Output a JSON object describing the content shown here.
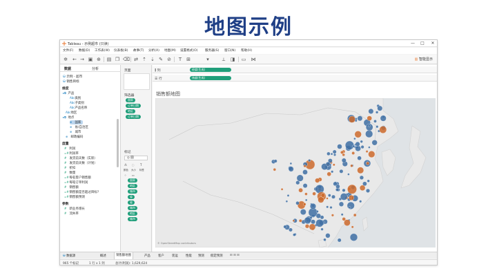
{
  "slide": {
    "title": "地图示例"
  },
  "window": {
    "title": "Tableau - 示例超市 (只读)",
    "controls": [
      "—",
      "□",
      "✕"
    ],
    "menu": [
      "文件(F)",
      "数据(D)",
      "工作表(W)",
      "仪表板(B)",
      "故事(T)",
      "分析(A)",
      "地图(M)",
      "设置格式(O)",
      "服务器(S)",
      "窗口(N)",
      "帮助(H)"
    ],
    "show_me": "智能显示"
  },
  "data_pane": {
    "tabs": [
      "数据",
      "分析"
    ],
    "datasources": [
      "示例 - 超市",
      "销售目标"
    ],
    "dimensions_label": "维度",
    "dimensions": [
      {
        "label": "产品",
        "type": "folder"
      },
      {
        "label": "类别",
        "type": "abc"
      },
      {
        "label": "子类别",
        "type": "abc"
      },
      {
        "label": "产品名称",
        "type": "abc"
      },
      {
        "label": "地区",
        "type": "abc"
      },
      {
        "label": "地点",
        "type": "folder"
      },
      {
        "label": "国家",
        "type": "geo",
        "selected": true
      },
      {
        "label": "省/自治区",
        "type": "geo"
      },
      {
        "label": "城市",
        "type": "geo"
      },
      {
        "label": "邮政编码",
        "type": "geo"
      }
    ],
    "measures_label": "度量",
    "measures": [
      "利润",
      "利润率",
      "发货前天数（实际）",
      "发货前天数（计划）",
      "折扣",
      "数量",
      "每名客户销售额",
      "每笔订单利润",
      "销售额",
      "销售额是否超过目标？",
      "销售额预测"
    ],
    "parameters_label": "参数",
    "parameters": [
      "新业务增长",
      "流失率"
    ]
  },
  "middle_pane": {
    "pages_label": "页面",
    "filters_label": "筛选器",
    "filters": [
      "国家",
      "订单日期",
      "地区",
      "订单日期"
    ],
    "marks_label": "标记",
    "mark_type": "◎ 圆",
    "mark_buttons": [
      "颜色",
      "大小",
      "标签",
      "详细信息",
      "工具提示"
    ],
    "mark_pills": [
      "国家",
      "地区",
      "城市",
      "省",
      "省",
      "城市",
      "地区",
      "城市"
    ]
  },
  "view": {
    "columns_label": "列",
    "rows_label": "行",
    "columns_pill": "经度(生成)",
    "rows_pill": "纬度(生成)",
    "sheet_title": "销售额地图",
    "attribution": "© OpenStreetMap contributors"
  },
  "tabs": {
    "data_source": "数据源",
    "sheets": [
      "概述",
      "销售额地图",
      "产品",
      "客户",
      "装运",
      "性能",
      "预测",
      "假定预测"
    ]
  },
  "status": {
    "marks": "965 个标记",
    "rows_cols": "1 行 x 1 列",
    "sum": "总计(利润): 1,629,624"
  },
  "colors": {
    "title": "#1f3f86",
    "pill_green": "#1f9e7a",
    "blue_mark": "#3e6fa3",
    "orange_mark": "#cc6a2c",
    "land": "#e8e8e8",
    "sea": "#dfe3e6"
  }
}
